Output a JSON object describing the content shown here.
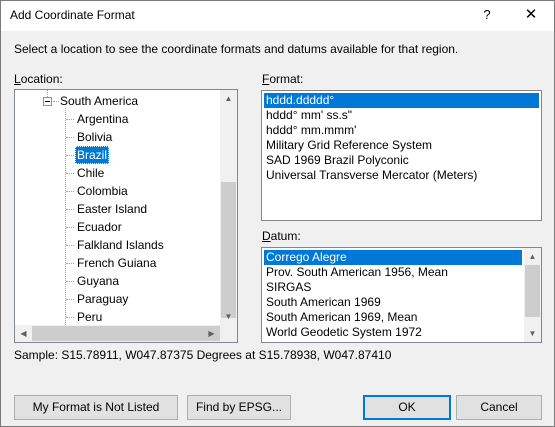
{
  "window": {
    "title": "Add Coordinate Format",
    "help_glyph": "?",
    "close_glyph": "✕"
  },
  "intro_text": "Select a location to see the coordinate formats and datums available for that region.",
  "location": {
    "label_u": "L",
    "label_rest": "ocation:",
    "parent": "South America",
    "items": [
      "Argentina",
      "Bolivia",
      "Brazil",
      "Chile",
      "Colombia",
      "Easter Island",
      "Ecuador",
      "Falkland Islands",
      "French Guiana",
      "Guyana",
      "Paraguay",
      "Peru"
    ],
    "selected": "Brazil"
  },
  "format": {
    "label_u": "F",
    "label_rest": "ormat:",
    "items": [
      "hddd.ddddd°",
      "hddd° mm' ss.s\"",
      "hddd° mm.mmm'",
      "Military Grid Reference System",
      "SAD 1969 Brazil Polyconic",
      "Universal Transverse Mercator (Meters)"
    ],
    "selected": "hddd.ddddd°"
  },
  "datum": {
    "label_u": "D",
    "label_rest": "atum:",
    "items": [
      "Corrego Alegre",
      "Prov. South American 1956, Mean",
      "SIRGAS",
      "South American 1969",
      "South American 1969, Mean",
      "World Geodetic System 1972"
    ],
    "selected": "Corrego Alegre"
  },
  "sample_text": "Sample: S15.78911, W047.87375 Degrees at S15.78938, W047.87410",
  "buttons": {
    "not_listed": "My Format is Not Listed",
    "find_epsg": "Find by EPSG...",
    "ok": "OK",
    "cancel": "Cancel"
  },
  "colors": {
    "selection": "#0078d7"
  }
}
